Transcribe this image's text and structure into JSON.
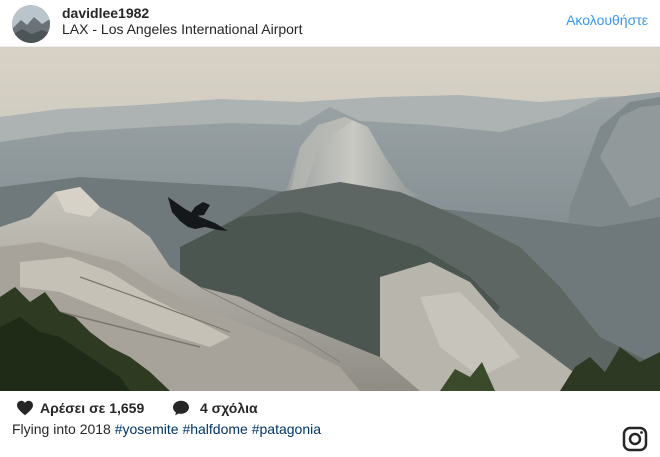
{
  "post": {
    "username": "davidlee1982",
    "location": "LAX - Los Angeles International Airport",
    "follow_label": "Ακολουθήστε"
  },
  "photo": {
    "subject": "Half Dome, Yosemite"
  },
  "actions": {
    "likes_text": "Αρέσει σε 1,659",
    "comments_text": "4 σχόλια",
    "heart_icon": "heart-icon",
    "comment_icon": "comment-bubble-icon"
  },
  "caption": {
    "text": "Flying into 2018",
    "hashtags": [
      "#yosemite",
      "#halfdome",
      "#patagonia"
    ]
  },
  "colors": {
    "link": "#3897f0",
    "hashtag": "#003569",
    "text": "#262626"
  }
}
